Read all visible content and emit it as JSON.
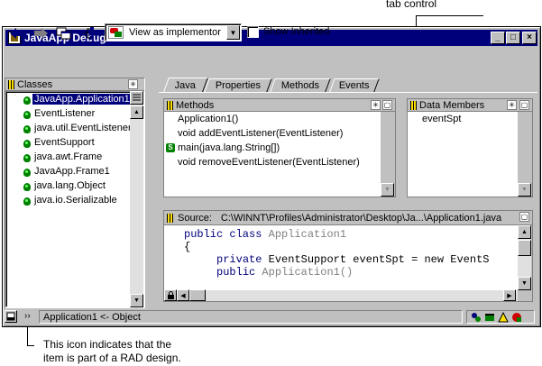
{
  "callouts": {
    "tab_control": "tab control",
    "rad_icon_line1": "This icon indicates that the",
    "rad_icon_line2": "item is part of a RAD design."
  },
  "window": {
    "title": "JavaApp Debug classes",
    "controls": [
      "_",
      "□",
      "×"
    ]
  },
  "toolbar": {
    "back_icon": "left-arrow-icon",
    "forward_icon": "right-arrow-icon",
    "combo_value": "View as implementor",
    "show_inherited_label": "Show Inherited",
    "show_inherited_checked": false
  },
  "classes_panel": {
    "title": "Classes",
    "items": [
      {
        "label": "JavaApp.Application1",
        "selected": true
      },
      {
        "label": "EventListener"
      },
      {
        "label": "java.util.EventListener"
      },
      {
        "label": "EventSupport"
      },
      {
        "label": "java.awt.Frame"
      },
      {
        "label": "JavaApp.Frame1"
      },
      {
        "label": "java.lang.Object"
      },
      {
        "label": "java.io.Serializable"
      }
    ]
  },
  "tabs": [
    "Java",
    "Properties",
    "Methods",
    "Events"
  ],
  "active_tab": "Java",
  "methods_panel": {
    "title": "Methods",
    "items": [
      {
        "label": "Application1()"
      },
      {
        "label": "void addEventListener(EventListener)"
      },
      {
        "label": "main(java.lang.String[])",
        "static": true,
        "badge": "S"
      },
      {
        "label": "void removeEventListener(EventListener)"
      }
    ]
  },
  "data_members_panel": {
    "title": "Data Members",
    "items": [
      "eventSpt"
    ]
  },
  "source_panel": {
    "label": "Source:",
    "path": "C:\\WINNT\\Profiles\\Administrator\\Desktop\\Ja...\\Application1.java",
    "lines": [
      {
        "indent": "",
        "kw": "public class",
        "rest": " Application1",
        "rest_class": "cm"
      },
      {
        "indent": "",
        "kw": "",
        "rest": "{",
        "rest_class": ""
      },
      {
        "indent": "     ",
        "kw": "private",
        "rest": " EventSupport eventSpt = new EventS",
        "rest_class": "mix"
      },
      {
        "indent": "     ",
        "kw": "public",
        "rest": " Application1()",
        "rest_class": "cm"
      }
    ]
  },
  "status_bar": {
    "text": "Application1 <- Object"
  }
}
